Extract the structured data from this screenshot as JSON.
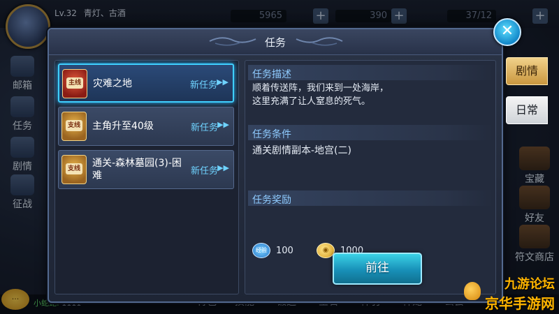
{
  "hud": {
    "level_text": "Lv.32",
    "player_title": "青灯、古酒",
    "res1": "5965",
    "res2": "390",
    "res3": "37/12",
    "nickname": "小蛇蛇:",
    "nickname_value": "1111",
    "left_nav": [
      "邮箱",
      "任务",
      "剧情",
      "征战"
    ],
    "right_nav": [
      "宝藏",
      "好友",
      "符文商店"
    ],
    "bottom_nav": [
      "背包",
      "技能",
      "锻造",
      "宝石",
      "神羽",
      "神宠",
      "公会"
    ],
    "watermark_line1": "九游论坛",
    "watermark_line2": "京华手游网"
  },
  "dialog": {
    "title": "任务",
    "close_icon": "close-x-icon",
    "quests": [
      {
        "badge": "主线",
        "name": "灾难之地",
        "tag": "新任务",
        "active": true
      },
      {
        "badge": "支线",
        "name": "主角升至40级",
        "tag": "新任务",
        "active": false
      },
      {
        "badge": "支线",
        "name": "通关-森林墓园(3)-困难",
        "tag": "新任务",
        "active": false
      }
    ],
    "detail": {
      "desc_header": "任务描述",
      "desc_text_line1": "顺着传送阵，我们来到一处海岸，",
      "desc_text_line2": "这里充满了让人窒息的死气。",
      "cond_header": "任务条件",
      "cond_text": "通关剧情副本-地宫(二)",
      "reward_header": "任务奖励",
      "rewards": [
        {
          "icon": "exp-icon",
          "icon_text": "经验",
          "value": "100"
        },
        {
          "icon": "gold-coin-icon",
          "icon_text": "",
          "value": "1000"
        }
      ],
      "go_button": "前往"
    },
    "side_tabs": [
      {
        "label": "剧情",
        "active": true
      },
      {
        "label": "日常",
        "active": false
      }
    ]
  }
}
